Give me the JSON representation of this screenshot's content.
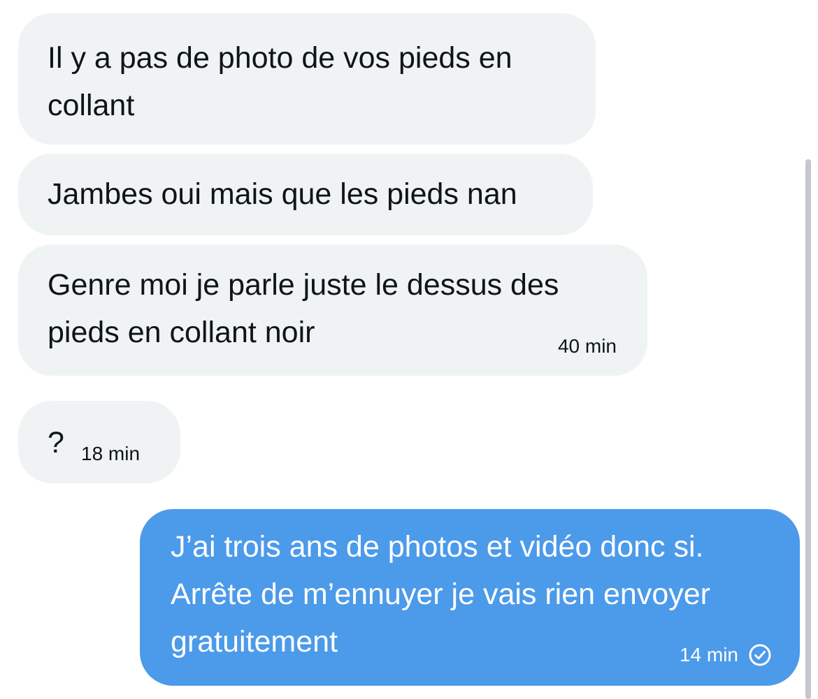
{
  "conversation": {
    "messages": [
      {
        "direction": "incoming",
        "text": "Il y a pas de photo de vos pieds en\ncollant",
        "time": ""
      },
      {
        "direction": "incoming",
        "text": "Jambes oui mais que les pieds nan",
        "time": ""
      },
      {
        "direction": "incoming",
        "text": "Genre moi je parle juste le dessus des\npieds en collant noir",
        "time": "40 min"
      },
      {
        "direction": "incoming",
        "text": "?",
        "time": "18 min"
      },
      {
        "direction": "outgoing",
        "text": "J’ai trois ans de photos et vidéo donc si.\nArrête de m’ennuyer je vais rien envoyer\ngratuitement",
        "time": "14 min",
        "status_icon": "check-circle-icon"
      }
    ]
  },
  "colors": {
    "incoming_bubble": "#eff3f4",
    "outgoing_bubble": "#4c9aea",
    "text_dark": "#0f1419",
    "text_light": "#ffffff"
  }
}
